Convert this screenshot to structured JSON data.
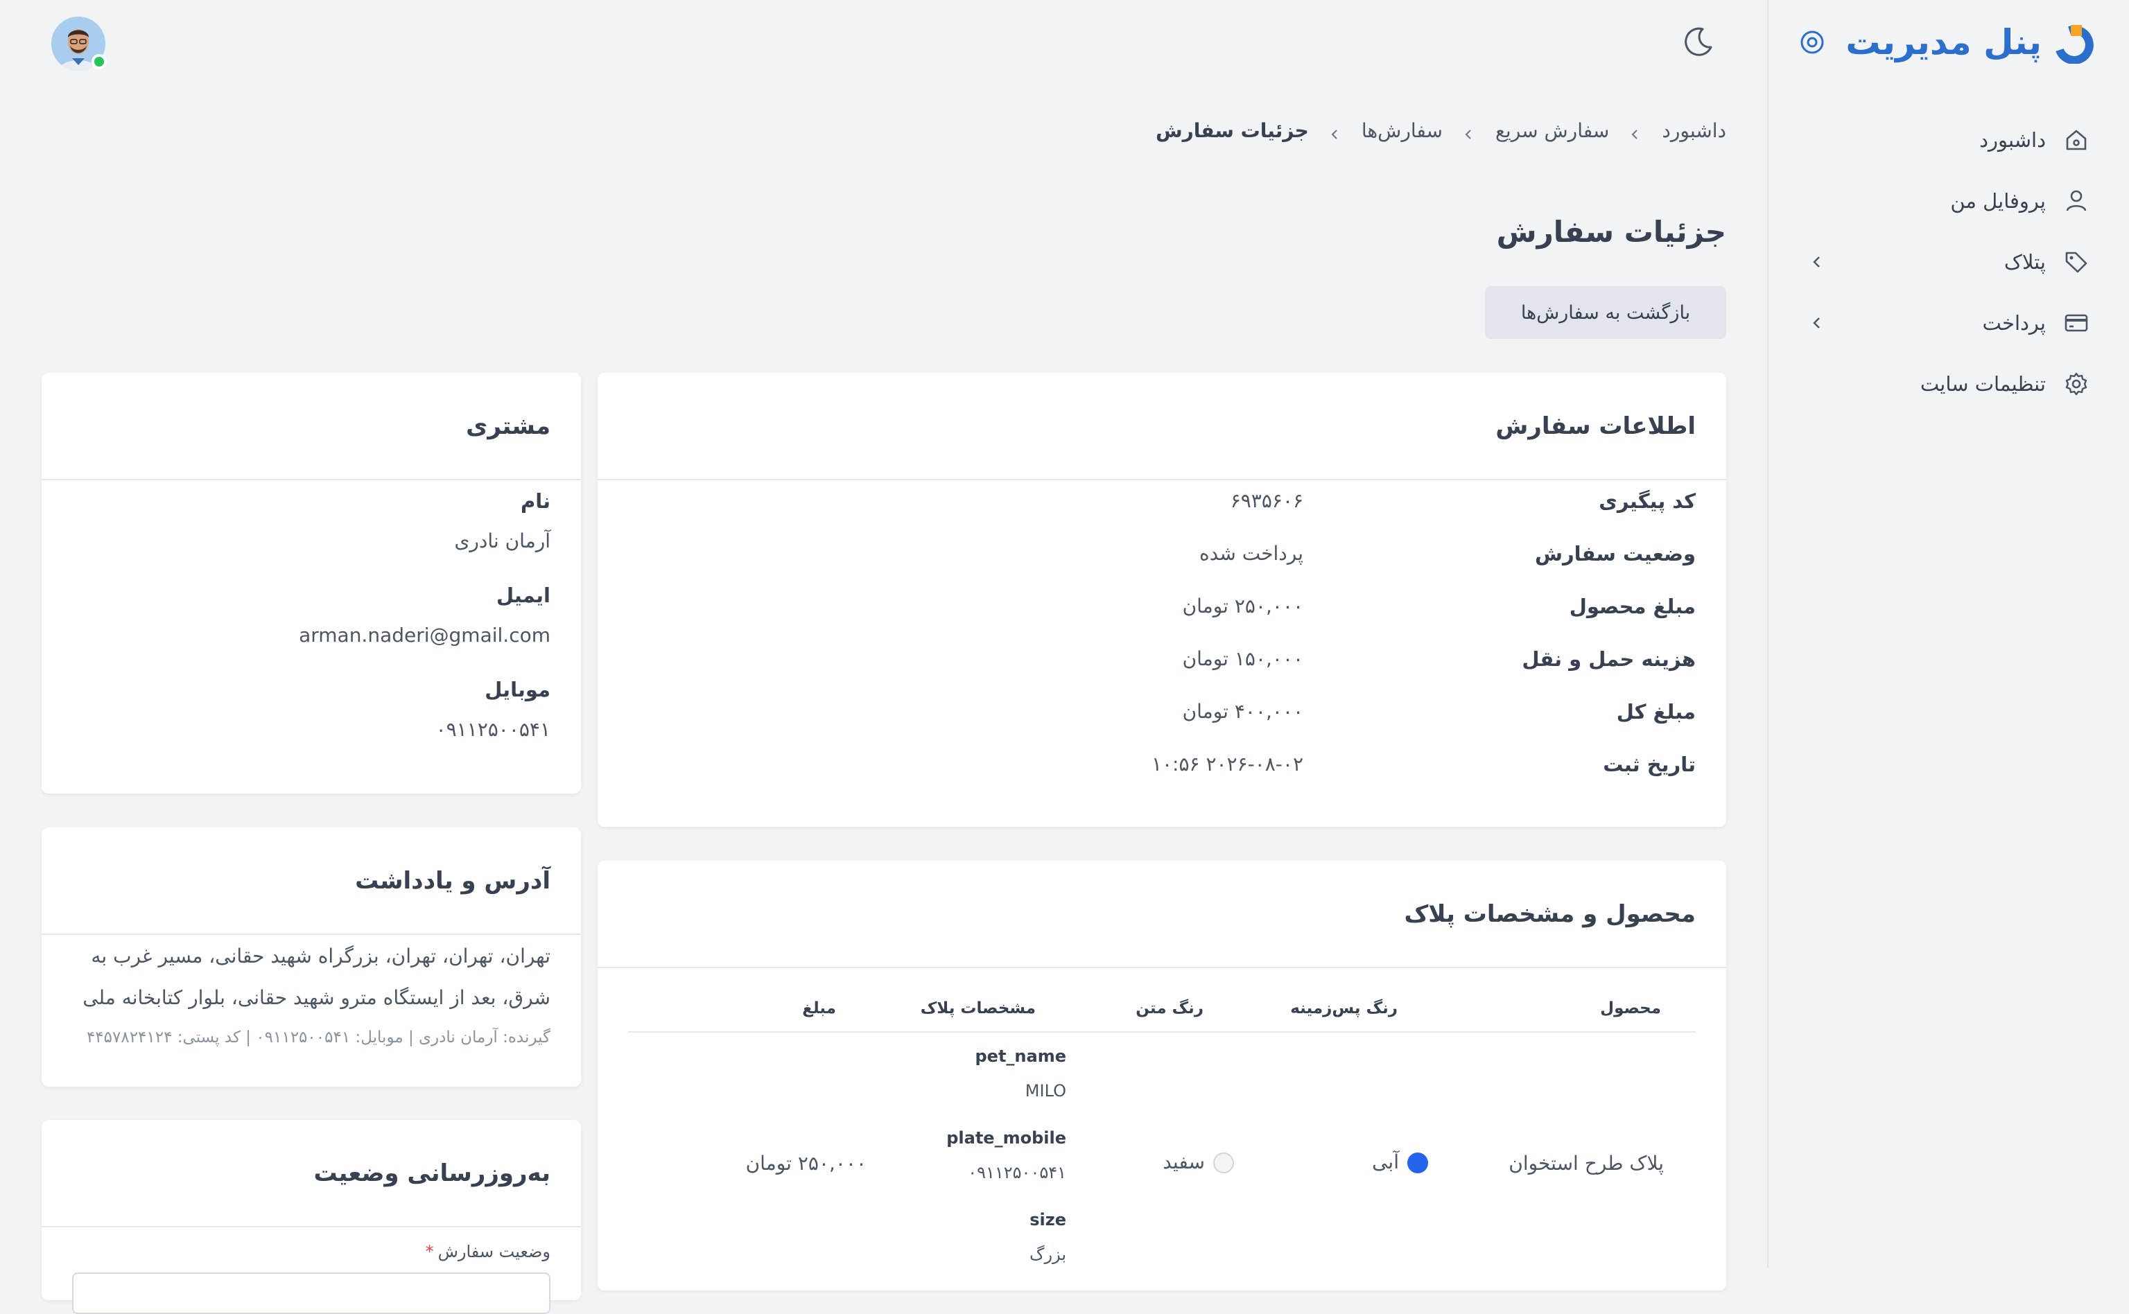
{
  "brand": {
    "title": "پنل مدیریت"
  },
  "nav": {
    "items": [
      {
        "label": "داشبورد",
        "icon": "home-icon"
      },
      {
        "label": "پروفایل من",
        "icon": "user-icon"
      },
      {
        "label": "پتلاک",
        "icon": "tag-icon",
        "has_children": true
      },
      {
        "label": "پرداخت",
        "icon": "credit-card-icon",
        "has_children": true
      },
      {
        "label": "تنظیمات سایت",
        "icon": "gear-icon"
      }
    ]
  },
  "breadcrumb": [
    "داشبورد",
    "سفارش سریع",
    "سفارش‌ها",
    "جزئیات سفارش"
  ],
  "page": {
    "title": "جزئیات سفارش",
    "back_label": "بازگشت به سفارش‌ها"
  },
  "order_info": {
    "title": "اطلاعات سفارش",
    "rows": [
      {
        "label": "کد پیگیری",
        "value": "۶۹۳۵۶۰۶"
      },
      {
        "label": "وضعیت سفارش",
        "value": "پرداخت شده"
      },
      {
        "label": "مبلغ محصول",
        "value": "۲۵۰,۰۰۰ تومان"
      },
      {
        "label": "هزینه حمل و نقل",
        "value": "۱۵۰,۰۰۰ تومان"
      },
      {
        "label": "مبلغ کل",
        "value": "۴۰۰,۰۰۰ تومان"
      },
      {
        "label": "تاریخ ثبت",
        "value": "۲۰۲۶-۰۸-۰۲ ۱۰:۵۶"
      }
    ]
  },
  "product": {
    "title": "محصول و مشخصات پلاک",
    "columns": [
      "محصول",
      "رنگ پس‌زمینه",
      "رنگ متن",
      "مشخصات پلاک",
      "مبلغ"
    ],
    "row": {
      "product": "پلاک طرح استخوان",
      "bg_color_name": "آبی",
      "bg_color": "#2563eb",
      "text_color_name": "سفید",
      "text_color": "#f3f4f6",
      "specs": [
        {
          "label": "pet_name",
          "value": "MILO"
        },
        {
          "label": "plate_mobile",
          "value": "۰۹۱۱۲۵۰۰۵۴۱"
        },
        {
          "label": "size",
          "value": "بزرگ"
        }
      ],
      "price": "۲۵۰,۰۰۰ تومان"
    }
  },
  "customer": {
    "title": "مشتری",
    "name_label": "نام",
    "name": "آرمان نادری",
    "email_label": "ایمیل",
    "email": "arman.naderi@gmail.com",
    "mobile_label": "موبایل",
    "mobile": "۰۹۱۱۲۵۰۰۵۴۱"
  },
  "address": {
    "title": "آدرس و یادداشت",
    "text": "تهران، تهران، تهران، بزرگراه شهید حقانی، مسیر غرب به شرق، بعد از ایستگاه مترو شهید حقانی، بلوار کتابخانه ملی",
    "meta": "گیرنده: آرمان نادری | موبایل: ۰۹۱۱۲۵۰۰۵۴۱ | کد پستی: ۴۴۵۷۸۲۴۱۲۴"
  },
  "status_update": {
    "title": "به‌روزرسانی وضعیت",
    "field_label": "وضعیت سفارش",
    "required_mark": "*"
  },
  "colors": {
    "accent": "#2c6ecb",
    "logo_orange": "#f5a524",
    "online": "#22c55e"
  }
}
